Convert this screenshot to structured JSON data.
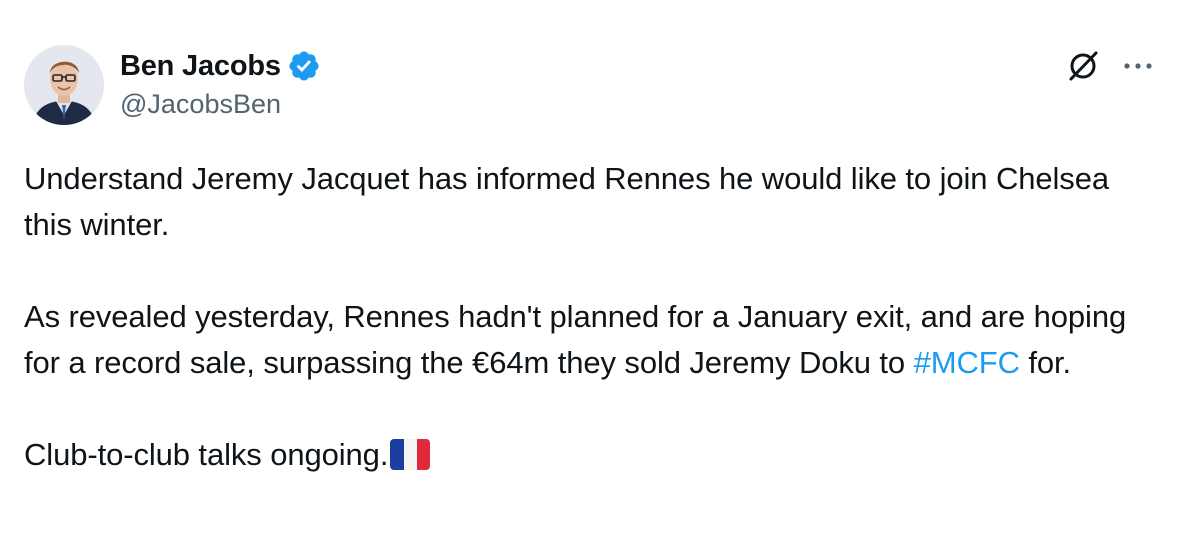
{
  "author": {
    "name": "Ben Jacobs",
    "handle": "@JacobsBen",
    "verified": true
  },
  "icons": {
    "avatar": "profile-photo",
    "verified": "verified-badge-icon",
    "grok": "grok-icon",
    "more": "more-options-icon",
    "flag": "france-flag-emoji"
  },
  "colors": {
    "text": "#0f1419",
    "secondary": "#536471",
    "accent": "#1d9bf0"
  },
  "tweet": {
    "para1": "Understand Jeremy Jacquet has informed Rennes he would like to join Chelsea this winter.",
    "para2_before": "As revealed yesterday, Rennes hadn't planned for a January exit, and are hoping for a record sale, surpassing the €64m they sold Jeremy Doku to ",
    "para2_hashtag": "#MCFC",
    "para2_after": " for.",
    "para3": "Club-to-club talks ongoing."
  }
}
